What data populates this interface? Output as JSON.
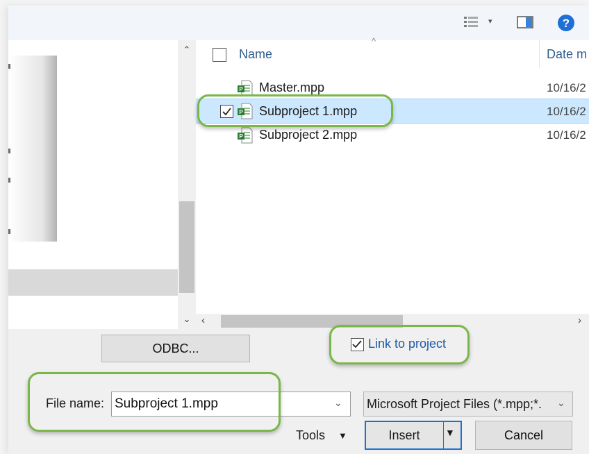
{
  "header": {
    "columns": {
      "name": "Name",
      "date": "Date m"
    }
  },
  "files": [
    {
      "name": "Master.mpp",
      "date": "10/16/2",
      "checked": false,
      "selected": false
    },
    {
      "name": "Subproject 1.mpp",
      "date": "10/16/2",
      "checked": true,
      "selected": true
    },
    {
      "name": "Subproject 2.mpp",
      "date": "10/16/2",
      "checked": false,
      "selected": false
    }
  ],
  "buttons": {
    "odbc": "ODBC...",
    "tools": "Tools",
    "insert": "Insert",
    "cancel": "Cancel"
  },
  "link_to_project": {
    "label": "Link to project",
    "checked": true
  },
  "file_name": {
    "label": "File name:",
    "value": "Subproject 1.mpp"
  },
  "file_type": {
    "selected": "Microsoft Project Files (*.mpp;*."
  },
  "icons": {
    "view": "list-view-icon",
    "preview": "preview-pane-icon",
    "help": "help-icon",
    "file": "project-file-icon"
  },
  "colors": {
    "accent": "#1f6fd1",
    "selection": "#cce8ff",
    "callout": "#7ab648",
    "link": "#1e5aa8"
  }
}
